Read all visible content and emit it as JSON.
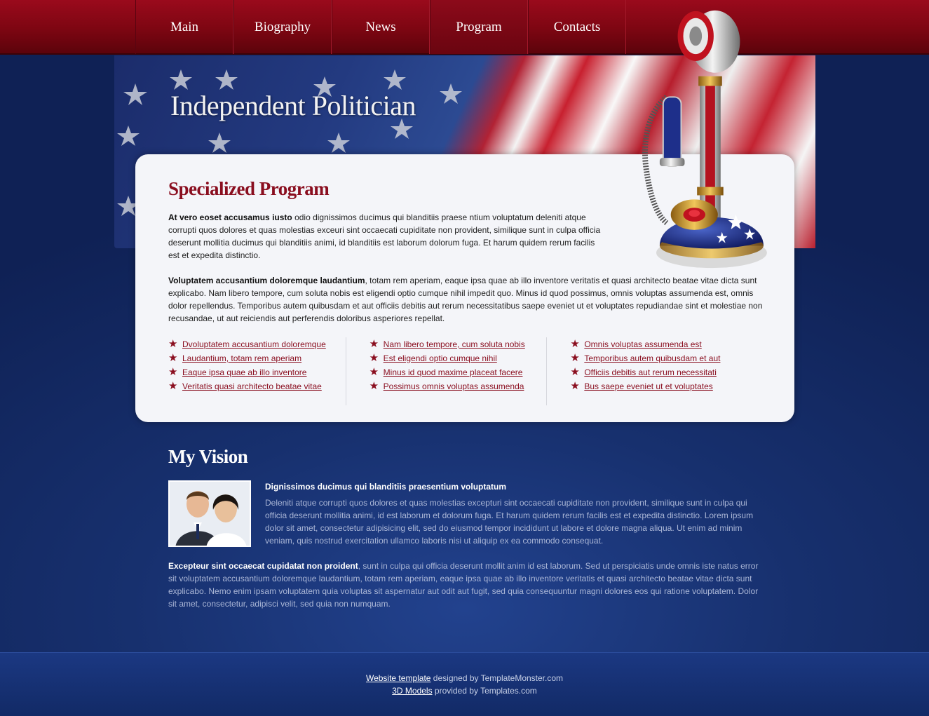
{
  "nav": {
    "items": [
      {
        "label": "Main"
      },
      {
        "label": "Biography"
      },
      {
        "label": "News"
      },
      {
        "label": "Program"
      },
      {
        "label": "Contacts"
      }
    ]
  },
  "banner": {
    "title": "Independent Politician"
  },
  "program": {
    "title": "Specialized Program",
    "p1_bold": "At vero eoset accusamus iusto",
    "p1_text": " odio dignissimos ducimus qui blanditiis praese ntium voluptatum deleniti atque corrupti quos dolores et quas molestias exceuri sint occaecati cupiditate non provident, similique sunt in culpa officia deserunt mollitia ducimus qui blanditiis animi, id blanditiis est laborum dolorum fuga. Et harum quidem rerum facilis est et expedita distinctio.",
    "p2_bold": "Voluptatem accusantium doloremque laudantium",
    "p2_text": ", totam rem aperiam, eaque ipsa quae ab illo inventore veritatis et quasi architecto beatae vitae dicta sunt explicabo. Nam libero tempore, cum soluta nobis est eligendi optio cumque nihil impedit quo. Minus id quod possimus, omnis voluptas assumenda est, omnis dolor repellendus. Temporibus autem quibusdam et aut officiis debitis aut rerum necessitatibus saepe eveniet ut et voluptates repudiandae sint et molestiae non recusandae, ut aut reiciendis aut perferendis doloribus asperiores repellat.",
    "lists": [
      [
        "Dvoluptatem accusantium doloremque",
        "Laudantium, totam rem aperiam",
        "Eaque ipsa quae ab illo inventore",
        "Veritatis quasi architecto beatae vitae"
      ],
      [
        "Nam libero tempore, cum soluta nobis",
        "Est eligendi optio cumque nihil",
        "Minus id quod maxime placeat facere",
        "Possimus omnis voluptas assumenda"
      ],
      [
        "Omnis voluptas assumenda est",
        "Temporibus autem quibusdam et aut",
        "Officiis debitis aut rerum necessitati",
        "Bus saepe eveniet ut et voluptates"
      ]
    ]
  },
  "vision": {
    "title": "My Vision",
    "heading": "Dignissimos ducimus qui blanditiis praesentium voluptatum",
    "text": "Deleniti atque corrupti quos dolores et quas molestias excepturi sint occaecati cupiditate non provident, similique sunt in culpa qui officia deserunt mollitia animi, id est laborum et dolorum fuga. Et harum quidem rerum facilis est et expedita distinctio. Lorem ipsum dolor sit amet, consectetur adipisicing elit, sed do eiusmod tempor incididunt ut labore et dolore magna aliqua. Ut enim ad minim veniam, quis nostrud exercitation ullamco laboris nisi ut aliquip ex ea commodo consequat.",
    "p2_bold": "Excepteur sint occaecat cupidatat non proident",
    "p2_text": ", sunt in culpa qui officia deserunt mollit anim id est laborum. Sed ut perspiciatis unde omnis iste natus error sit voluptatem accusantium doloremque laudantium, totam rem aperiam, eaque ipsa quae ab illo inventore veritatis et quasi architecto beatae vitae dicta sunt explicabo. Nemo enim ipsam voluptatem quia voluptas sit aspernatur aut odit aut fugit, sed quia consequuntur magni dolores eos qui ratione voluptatem. Dolor sit amet, consectetur, adipisci velit, sed quia non numquam."
  },
  "footer": {
    "link1": "Website template",
    "text1": " designed by TemplateMonster.com",
    "link2": "3D Models",
    "text2": " provided by Templates.com"
  },
  "colors": {
    "nav_red": "#7d0612",
    "accent_red": "#8a0e1f",
    "background_blue": "#17306e"
  }
}
